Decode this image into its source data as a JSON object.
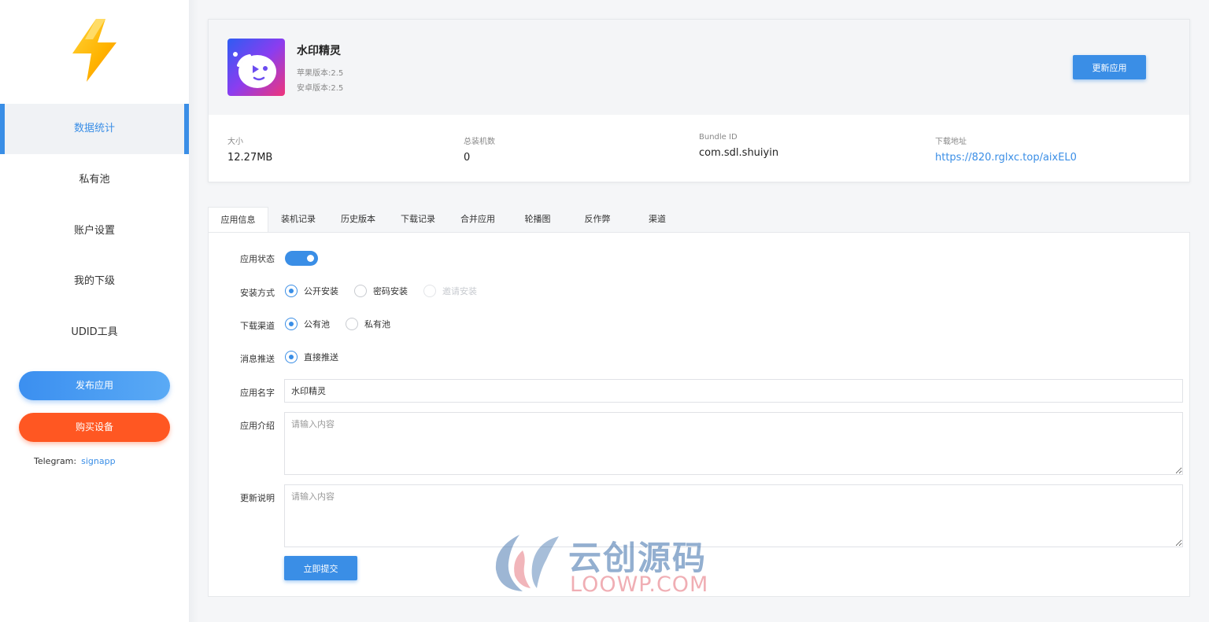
{
  "sidebar": {
    "logo_icon": "lightning-bolt-icon",
    "items": [
      {
        "label": "数据统计",
        "active": true
      },
      {
        "label": "私有池",
        "active": false
      },
      {
        "label": "账户设置",
        "active": false
      },
      {
        "label": "我的下级",
        "active": false
      },
      {
        "label": "UDID工具",
        "active": false
      }
    ],
    "publish_label": "发布应用",
    "buy_label": "购买设备",
    "telegram_label": "Telegram:",
    "telegram_handle": "signapp"
  },
  "app": {
    "name": "水印精灵",
    "ios_version": "苹果版本:2.5",
    "android_version": "安卓版本:2.5",
    "update_label": "更新应用",
    "stats": {
      "size_label": "大小",
      "size_value": "12.27MB",
      "installs_label": "总装机数",
      "installs_value": "0",
      "bundle_label": "Bundle ID",
      "bundle_value": "com.sdl.shuiyin",
      "download_label": "下载地址",
      "download_value": "https://820.rglxc.top/aixEL0"
    }
  },
  "tabs": [
    "应用信息",
    "装机记录",
    "历史版本",
    "下载记录",
    "合并应用",
    "轮播图",
    "反作弊",
    "渠道"
  ],
  "form": {
    "status_label": "应用状态",
    "status_on": true,
    "install_label": "安装方式",
    "install_options": [
      {
        "label": "公开安装",
        "checked": true,
        "disabled": false
      },
      {
        "label": "密码安装",
        "checked": false,
        "disabled": false
      },
      {
        "label": "邀请安装",
        "checked": false,
        "disabled": true
      }
    ],
    "channel_label": "下载渠道",
    "channel_options": [
      {
        "label": "公有池",
        "checked": true
      },
      {
        "label": "私有池",
        "checked": false
      }
    ],
    "push_label": "消息推送",
    "push_options": [
      {
        "label": "直接推送",
        "checked": true
      }
    ],
    "name_label": "应用名字",
    "name_value": "水印精灵",
    "intro_label": "应用介绍",
    "intro_placeholder": "请输入内容",
    "notes_label": "更新说明",
    "notes_placeholder": "请输入内容",
    "submit_label": "立即提交"
  },
  "watermark": {
    "cn": "云创源码",
    "en": "LOOWP.COM"
  },
  "colors": {
    "primary": "#3a8ee6",
    "danger": "#ff5722"
  }
}
